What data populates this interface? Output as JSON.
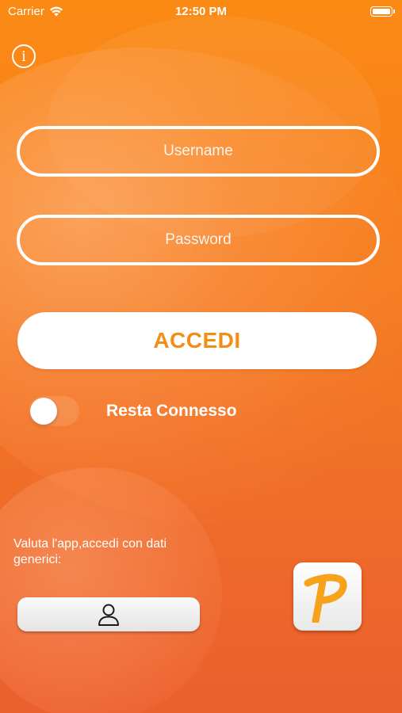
{
  "status_bar": {
    "carrier": "Carrier",
    "time": "12:50 PM",
    "battery_level": 1.0
  },
  "icons": {
    "info": "info-icon",
    "wifi": "wifi-icon",
    "battery": "battery-icon",
    "user": "user-icon",
    "logo": "app-logo-p"
  },
  "login": {
    "username_placeholder": "Username",
    "password_placeholder": "Password",
    "submit_label": "ACCEDI"
  },
  "remember": {
    "label": "Resta Connesso",
    "enabled": false
  },
  "guest": {
    "text": "Valuta l'app,accedi con dati generici:"
  },
  "colors": {
    "accent": "#f48d14",
    "background_top": "#fb8a14",
    "background_bottom": "#ec5f2e"
  }
}
